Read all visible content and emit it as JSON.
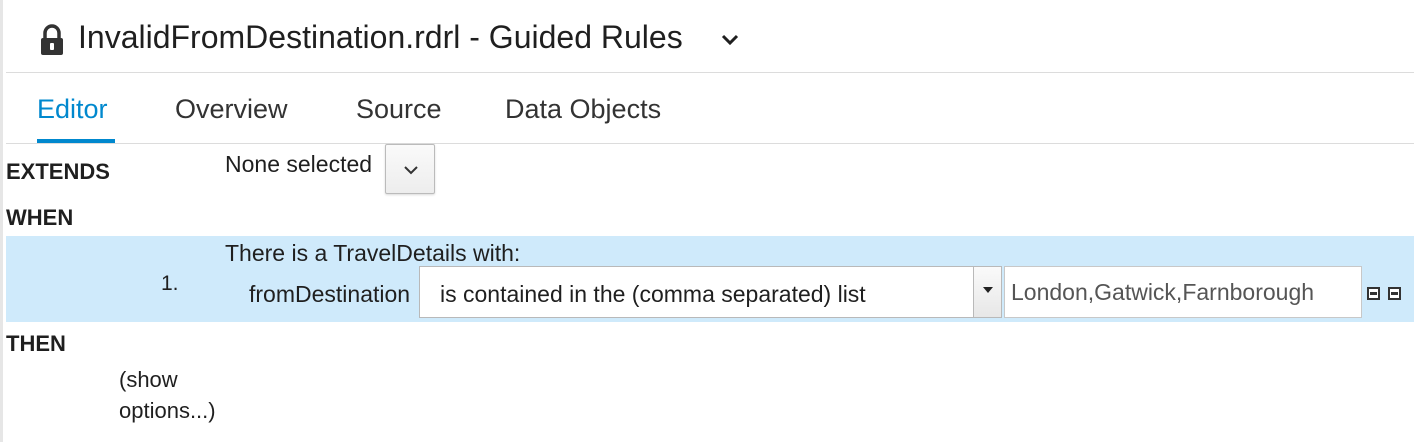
{
  "header": {
    "title": "InvalidFromDestination.rdrl - Guided Rules",
    "lock_icon": "lock-icon",
    "dropdown_icon": "chevron-down-icon"
  },
  "tabs": [
    {
      "label": "Editor",
      "active": true
    },
    {
      "label": "Overview",
      "active": false
    },
    {
      "label": "Source",
      "active": false
    },
    {
      "label": "Data Objects",
      "active": false
    }
  ],
  "rule": {
    "extends_label": "EXTENDS",
    "extends_value": "None selected",
    "when_label": "WHEN",
    "conditions": [
      {
        "number": "1.",
        "pattern": "There is a TravelDetails with:",
        "field": "fromDestination",
        "operator": "is contained in the (comma separated) list",
        "value": "London,Gatwick,Farnborough"
      }
    ],
    "then_label": "THEN",
    "show_options": "(show options...)"
  },
  "colors": {
    "accent": "#0088ce",
    "row_highlight": "#cfeafb"
  }
}
